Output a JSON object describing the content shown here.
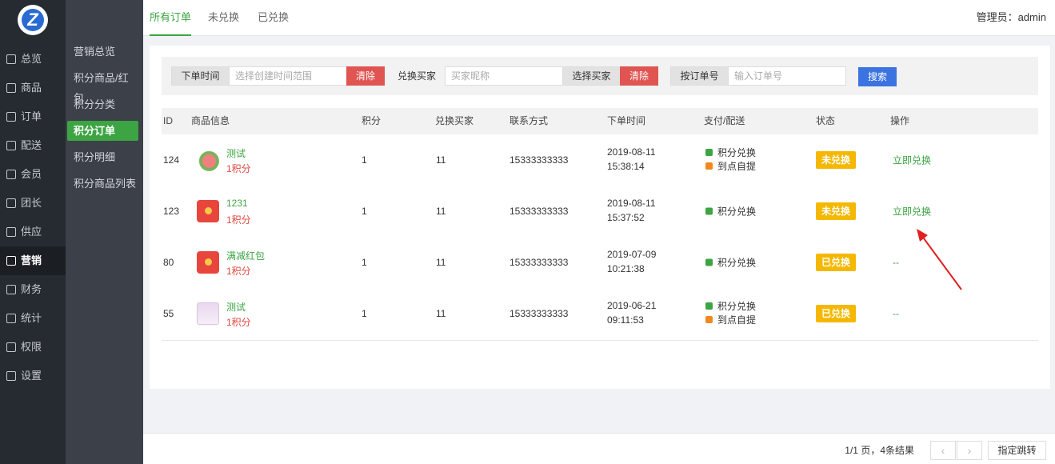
{
  "logo_letter": "Z",
  "nav_primary": [
    {
      "label": "总览",
      "icon": "home-icon"
    },
    {
      "label": "商品",
      "icon": "goods-icon"
    },
    {
      "label": "订单",
      "icon": "order-icon"
    },
    {
      "label": "配送",
      "icon": "delivery-icon"
    },
    {
      "label": "会员",
      "icon": "member-icon"
    },
    {
      "label": "团长",
      "icon": "leader-icon"
    },
    {
      "label": "供应",
      "icon": "supply-icon"
    },
    {
      "label": "营销",
      "icon": "gift-icon",
      "active": true
    },
    {
      "label": "财务",
      "icon": "finance-icon"
    },
    {
      "label": "统计",
      "icon": "stats-icon"
    },
    {
      "label": "权限",
      "icon": "shield-icon"
    },
    {
      "label": "设置",
      "icon": "gear-icon"
    }
  ],
  "nav_secondary": [
    {
      "label": "营销总览"
    },
    {
      "label": "积分商品/红包"
    },
    {
      "label": "积分分类"
    },
    {
      "label": "积分订单",
      "active": true
    },
    {
      "label": "积分明细"
    },
    {
      "label": "积分商品列表"
    }
  ],
  "tabs": [
    {
      "label": "所有订单",
      "active": true
    },
    {
      "label": "未兑换"
    },
    {
      "label": "已兑换"
    }
  ],
  "admin_label": "管理员：",
  "admin_name": "admin",
  "filter": {
    "time_label": "下单时间",
    "time_placeholder": "选择创建时间范围",
    "clear1": "清除",
    "buyer_label": "兑换买家",
    "buyer_placeholder": "买家昵称",
    "choose_buyer": "选择买家",
    "clear2": "清除",
    "order_label": "按订单号",
    "order_placeholder": "输入订单号",
    "search": "搜索"
  },
  "columns": [
    "ID",
    "商品信息",
    "积分",
    "兑换买家",
    "联系方式",
    "下单时间",
    "支付/配送",
    "状态",
    "操作"
  ],
  "rows": [
    {
      "id": "124",
      "name": "测试",
      "score": "1积分",
      "points": "1",
      "buyer": "11",
      "phone": "15333333333",
      "date": "2019-08-11",
      "time": "15:38:14",
      "pay": [
        "积分兑换",
        "到点自提"
      ],
      "status": "未兑换",
      "op": "立即兑换"
    },
    {
      "id": "123",
      "name": "1231",
      "score": "1积分",
      "points": "1",
      "buyer": "11",
      "phone": "15333333333",
      "date": "2019-08-11",
      "time": "15:37:52",
      "pay": [
        "积分兑换"
      ],
      "status": "未兑换",
      "op": "立即兑换"
    },
    {
      "id": "80",
      "name": "满减红包",
      "score": "1积分",
      "points": "1",
      "buyer": "11",
      "phone": "15333333333",
      "date": "2019-07-09",
      "time": "10:21:38",
      "pay": [
        "积分兑换"
      ],
      "status": "已兑换",
      "op": "--"
    },
    {
      "id": "55",
      "name": "测试",
      "score": "1积分",
      "points": "1",
      "buyer": "11",
      "phone": "15333333333",
      "date": "2019-06-21",
      "time": "09:11:53",
      "pay": [
        "积分兑换",
        "到点自提"
      ],
      "status": "已兑换",
      "op": "--"
    }
  ],
  "pagination": {
    "summary": "1/1 页，4条结果",
    "prev": "‹",
    "next": "›",
    "jump": "指定跳转"
  }
}
